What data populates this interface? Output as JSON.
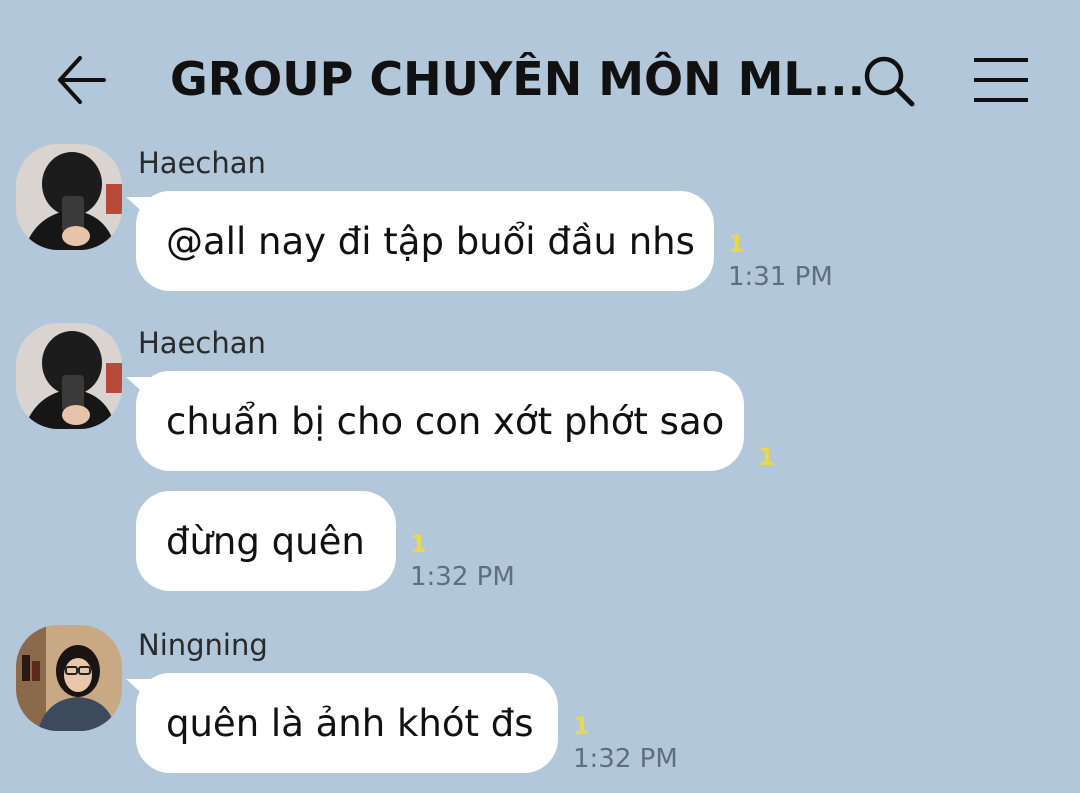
{
  "header": {
    "title": "GROUP CHUYÊN MÔN ML...",
    "back_icon": "arrow-left-icon",
    "search_icon": "search-icon",
    "menu_icon": "hamburger-menu-icon"
  },
  "messages": [
    {
      "sender": "Haechan",
      "text": "@all nay đi tập buổi đầu nhs",
      "unread": "1",
      "time": "1:31 PM"
    },
    {
      "sender": "Haechan",
      "text": "chuẩn bị cho con xớt phớt sao",
      "unread": "1",
      "time": ""
    },
    {
      "sender": "",
      "text": "đừng quên",
      "unread": "1",
      "time": "1:32 PM"
    },
    {
      "sender": "Ningning",
      "text": "quên là ảnh khót đs",
      "unread": "1",
      "time": "1:32 PM"
    }
  ],
  "colors": {
    "background": "#b2c7da",
    "bubble": "#ffffff",
    "unread": "#e8d84a",
    "time": "#5f6f7d"
  }
}
